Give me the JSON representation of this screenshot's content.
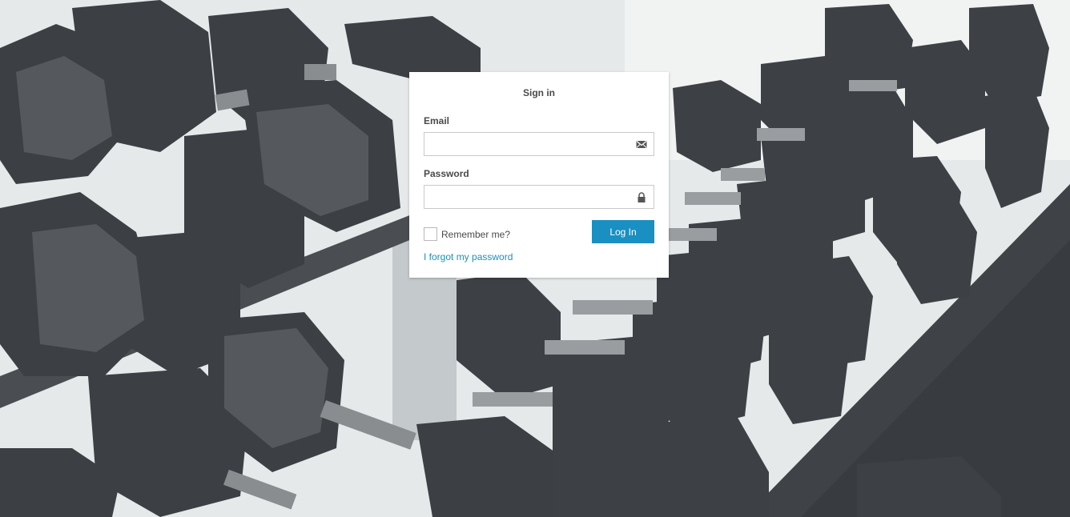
{
  "login": {
    "title": "Sign in",
    "email_label": "Email",
    "email_value": "",
    "password_label": "Password",
    "password_value": "",
    "remember_label": "Remember me?",
    "login_button": "Log In",
    "forgot_link": "I forgot my password"
  },
  "icons": {
    "email": "envelope-icon",
    "password": "lock-icon"
  },
  "colors": {
    "accent": "#1a8fc2",
    "card_bg": "#ffffff",
    "text": "#4a4a4a"
  }
}
